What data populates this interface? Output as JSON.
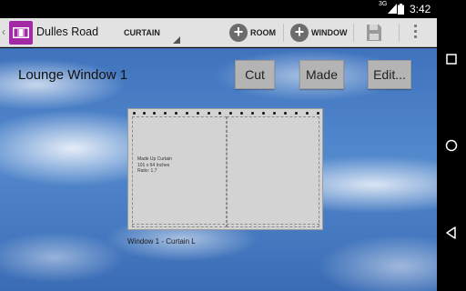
{
  "status_bar": {
    "signal_label": "3G",
    "time": "3:42"
  },
  "action_bar": {
    "title": "Dulles Road",
    "selector_value": "CURTAIN",
    "room_label": "ROOM",
    "window_label": "WINDOW",
    "icons": [
      "back-chevron",
      "curtain-app-icon",
      "add-room-icon",
      "add-window-icon",
      "save-icon",
      "overflow-icon"
    ]
  },
  "content": {
    "window_title": "Lounge Window 1",
    "buttons": {
      "cut": "Cut",
      "made": "Made",
      "edit": "Edit..."
    },
    "curtain": {
      "info_line1": "Made Up Curtain",
      "info_line2": "101 x 64 Inches",
      "info_line3": "Ratio: 1.7",
      "caption": "Window 1 - Curtain L"
    }
  },
  "colors": {
    "app_icon": "#a32aa6",
    "action_bar": "#e2e2e2",
    "button": "#b4b4b4",
    "sky": "#4a7fc6"
  }
}
